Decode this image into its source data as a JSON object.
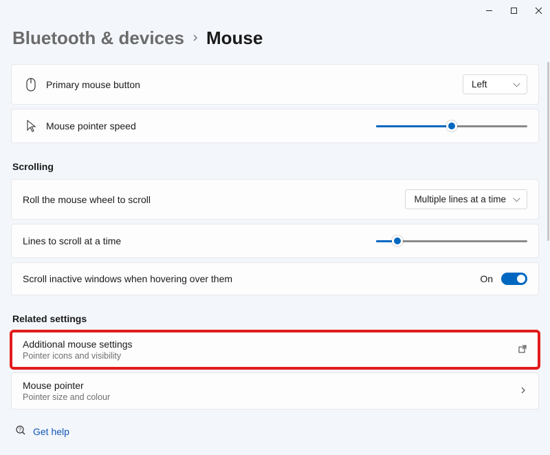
{
  "breadcrumb": {
    "parent": "Bluetooth & devices",
    "current": "Mouse"
  },
  "primary_button": {
    "label": "Primary mouse button",
    "value": "Left"
  },
  "pointer_speed": {
    "label": "Mouse pointer speed",
    "percent": 50
  },
  "sections": {
    "scrolling": "Scrolling",
    "related": "Related settings"
  },
  "wheel_scroll": {
    "label": "Roll the mouse wheel to scroll",
    "value": "Multiple lines at a time"
  },
  "lines_scroll": {
    "label": "Lines to scroll at a time",
    "percent": 14
  },
  "inactive_windows": {
    "label": "Scroll inactive windows when hovering over them",
    "state_label": "On",
    "state": true
  },
  "links": {
    "additional": {
      "title": "Additional mouse settings",
      "subtitle": "Pointer icons and visibility"
    },
    "pointer": {
      "title": "Mouse pointer",
      "subtitle": "Pointer size and colour"
    }
  },
  "help": {
    "label": "Get help"
  },
  "colors": {
    "accent": "#0067c0",
    "highlight": "#e21b1b"
  }
}
